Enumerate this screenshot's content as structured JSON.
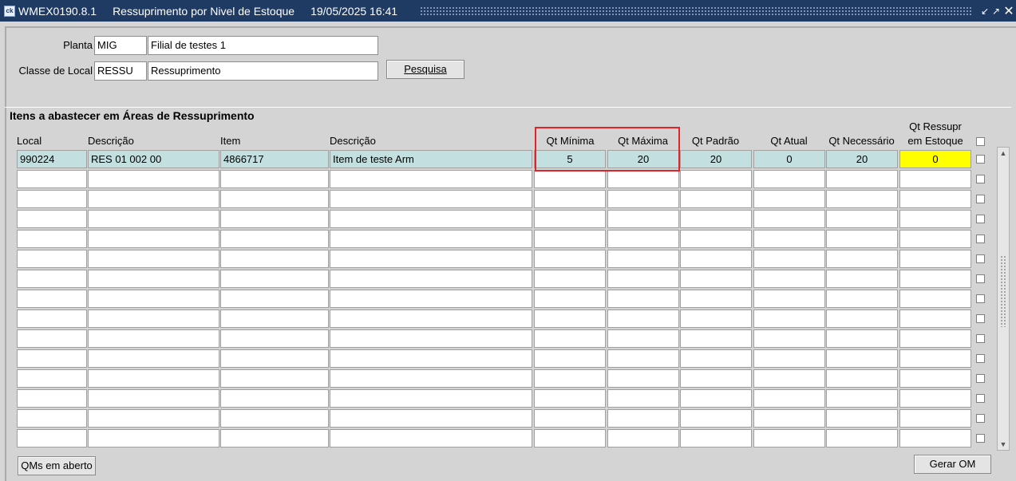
{
  "titlebar": {
    "code": "WMEX0190.8.1",
    "title": "Ressuprimento por Nivel de Estoque",
    "datetime": "19/05/2025 16:41"
  },
  "header": {
    "planta_label": "Planta",
    "planta_code": "MIG",
    "planta_desc": "Filial de testes 1",
    "classe_label": "Classe de Local",
    "classe_code": "RESSU",
    "classe_desc": "Ressuprimento",
    "pesquisa_button": "Pesquisa"
  },
  "section": {
    "title": "Itens a abastecer em Áreas de Ressuprimento"
  },
  "columns": {
    "local": "Local",
    "descricao1": "Descrição",
    "item": "Item",
    "descricao2": "Descrição",
    "qt_minima": "Qt Mínima",
    "qt_maxima": "Qt Máxima",
    "qt_padrao": "Qt Padrão",
    "qt_atual": "Qt Atual",
    "qt_necessario": "Qt Necessário",
    "qt_ressupr_line1": "Qt  Ressupr",
    "qt_ressupr_line2": "em Estoque"
  },
  "rows": [
    {
      "local": "990224",
      "descricao1": "RES 01 002 00",
      "item": "4866717",
      "descricao2": "Item de teste Arm",
      "qt_minima": "5",
      "qt_maxima": "20",
      "qt_padrao": "20",
      "qt_atual": "0",
      "qt_necessario": "20",
      "qt_ressupr": "0"
    }
  ],
  "footer": {
    "oms_button": "QMs em aberto",
    "gerar_button": "Gerar OM"
  }
}
